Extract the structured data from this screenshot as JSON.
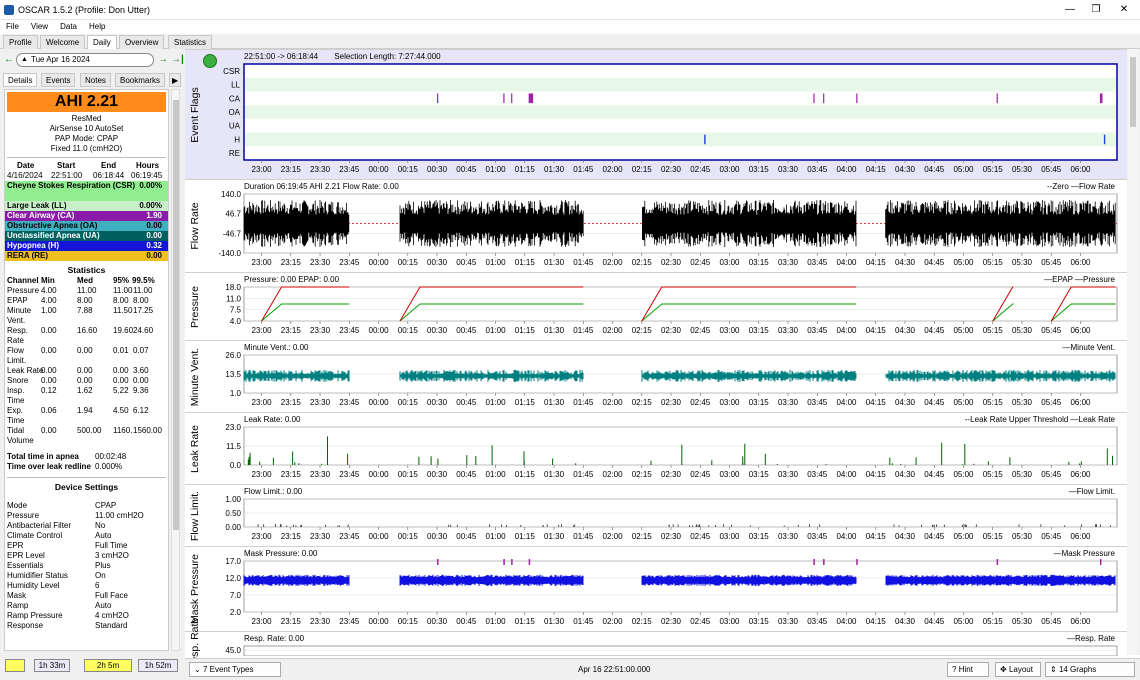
{
  "window": {
    "title": "OSCAR 1.5.2 (Profile: Don Utter)",
    "minimize": "—",
    "maximize": "❐",
    "close": "✕"
  },
  "menu": [
    "File",
    "View",
    "Data",
    "Help"
  ],
  "tabs": [
    "Profile",
    "Welcome",
    "Daily",
    "Overview",
    "Statistics"
  ],
  "active_tab": "Daily",
  "left": {
    "date": "Tue Apr 16 2024",
    "subtabs": [
      "Details",
      "Events",
      "Notes",
      "Bookmarks"
    ],
    "ahi": "AHI 2.21",
    "device": [
      "ResMed",
      "AirSense 10 AutoSet",
      "PAP Mode: CPAP",
      "Fixed 11.0 (cmH2O)"
    ],
    "session_headers": [
      "Date",
      "Start",
      "End",
      "Hours"
    ],
    "session_values": [
      "4/16/2024",
      "22:51:00",
      "06:18:44",
      "06:19:45"
    ],
    "events": [
      {
        "name": "Cheyne Stokes Respiration (CSR)",
        "value": "0.00%",
        "color": "#90ee90"
      },
      {
        "name": "Large Leak (LL)",
        "value": "0.00%",
        "color": "#c8f0c8"
      },
      {
        "name": "Clear Airway (CA)",
        "value": "1.90",
        "color": "#8a1aa8"
      },
      {
        "name": "Obstructive Apnea (OA)",
        "value": "0.00",
        "color": "#3fb0c0"
      },
      {
        "name": "Unclassified Apnea (UA)",
        "value": "0.00",
        "color": "#006060"
      },
      {
        "name": "Hypopnea (H)",
        "value": "0.32",
        "color": "#1515d8"
      },
      {
        "name": "RERA (RE)",
        "value": "0.00",
        "color": "#f0c020"
      }
    ],
    "stats_title": "Statistics",
    "stats_headers": [
      "Channel",
      "Min",
      "Med",
      "95%",
      "99.5%"
    ],
    "stats_rows": [
      {
        "name": [
          "Pressure"
        ],
        "min": "4.00",
        "med": "11.00",
        "p95": "11.00",
        "p995": "11.00"
      },
      {
        "name": [
          "EPAP"
        ],
        "min": "4.00",
        "med": "8.00",
        "p95": "8.00",
        "p995": "8.00"
      },
      {
        "name": [
          "Minute",
          "Vent."
        ],
        "min": "1.00",
        "med": "7.88",
        "p95": "11.50",
        "p995": "17.25"
      },
      {
        "name": [
          "Resp.",
          "Rate"
        ],
        "min": "0.00",
        "med": "16.60",
        "p95": "19.60",
        "p995": "24.60"
      },
      {
        "name": [
          "Flow",
          "Limit."
        ],
        "min": "0.00",
        "med": "0.00",
        "p95": "0.01",
        "p995": "0.07"
      },
      {
        "name": [
          "Leak Rate"
        ],
        "min": "0.00",
        "med": "0.00",
        "p95": "0.00",
        "p995": "3.60"
      },
      {
        "name": [
          "Snore"
        ],
        "min": "0.00",
        "med": "0.00",
        "p95": "0.00",
        "p995": "0.00"
      },
      {
        "name": [
          "Insp.",
          "Time"
        ],
        "min": "0.12",
        "med": "1.62",
        "p95": "5.22",
        "p995": "9.36"
      },
      {
        "name": [
          "Exp.",
          "Time"
        ],
        "min": "0.06",
        "med": "1.94",
        "p95": "4.50",
        "p995": "6.12"
      },
      {
        "name": [
          "Tidal",
          "Volume"
        ],
        "min": "0.00",
        "med": "500.00",
        "p95": "1160.",
        "p995": "1560.00"
      }
    ],
    "apnea_time_label": "Total time in apnea",
    "apnea_time": "00:02:48",
    "leak_label": "Time over leak redline",
    "leak_value": "0.000%",
    "settings_title": "Device Settings",
    "settings": [
      [
        "Mode",
        "CPAP"
      ],
      [
        "Pressure",
        "11.00 cmH2O"
      ],
      [
        "Antibacterial Filter",
        "No"
      ],
      [
        "Climate Control",
        "Auto"
      ],
      [
        "EPR",
        "Full Time"
      ],
      [
        "EPR Level",
        "3 cmH2O"
      ],
      [
        "Essentials",
        "Plus"
      ],
      [
        "Humidifier Status",
        "On"
      ],
      [
        "Humidity Level",
        "6"
      ],
      [
        "Mask",
        "Full Face"
      ],
      [
        "Ramp",
        "Auto"
      ],
      [
        "Ramp Pressure",
        "4 cmH2O"
      ],
      [
        "Response",
        "Standard"
      ]
    ],
    "bottom": [
      "",
      "1h 33m",
      "2h 5m",
      "1h 52m"
    ]
  },
  "graphs": {
    "x_ticks": [
      "23:00",
      "23:15",
      "23:30",
      "23:45",
      "00:00",
      "00:15",
      "00:30",
      "00:45",
      "01:00",
      "01:15",
      "01:30",
      "01:45",
      "02:00",
      "02:15",
      "02:30",
      "02:45",
      "03:00",
      "03:15",
      "03:30",
      "03:45",
      "04:00",
      "04:15",
      "04:30",
      "04:45",
      "05:00",
      "05:15",
      "05:30",
      "05:45",
      "06:00"
    ],
    "flags": {
      "label": "Event Flags",
      "header_range": "22:51:00 -> 06:18:44",
      "header_sel": "Selection Length: 7:27:44.000",
      "rows": [
        "CSR",
        "LL",
        "CA",
        "OA",
        "UA",
        "H",
        "RE"
      ],
      "ca_events": [
        "00:30",
        "01:04",
        "01:08",
        "01:17",
        "01:18",
        "03:43",
        "03:48",
        "04:05",
        "05:17",
        "06:10"
      ],
      "h_events": [
        "02:47",
        "06:12"
      ]
    },
    "flow": {
      "label": "Flow Rate",
      "header": "Duration 06:19:45 AHI 2.21 Flow Rate: 0.00",
      "legend": "--Zero —Flow Rate",
      "yticks": [
        "140.0",
        "46.7",
        "-46.7",
        "-140.0"
      ]
    },
    "pressure": {
      "label": "Pressure",
      "header": "Pressure: 0.00 EPAP: 0.00",
      "legend": "—EPAP —Pressure",
      "yticks": [
        "18.0",
        "11.0",
        "7.5",
        "4.0"
      ]
    },
    "minvent": {
      "label": "Minute Vent.",
      "header": "Minute Vent.: 0.00",
      "legend": "—Minute Vent.",
      "yticks": [
        "26.0",
        "13.5",
        "1.0"
      ]
    },
    "leak": {
      "label": "Leak Rate",
      "header": "Leak Rate: 0.00",
      "legend": "--Leak Rate Upper Threshold —Leak Rate",
      "yticks": [
        "23.0",
        "11.5",
        "0.0"
      ]
    },
    "flowlim": {
      "label": "Flow Limit.",
      "header": "Flow Limit.: 0.00",
      "legend": "—Flow Limit.",
      "yticks": [
        "1.00",
        "0.50",
        "0.00"
      ]
    },
    "mask": {
      "label": "Mask Pressure",
      "header": "Mask Pressure: 0.00",
      "legend": "—Mask Pressure",
      "yticks": [
        "17.0",
        "12.0",
        "7.0",
        "2.0"
      ]
    },
    "resp": {
      "label": "Resp. Rate",
      "header": "Resp. Rate: 0.00",
      "legend": "—Resp. Rate",
      "yticks": [
        "45.0"
      ]
    }
  },
  "status": {
    "event_types": "7 Event Types",
    "datetime": "Apr 16 22:51:00.000",
    "hint": "Hint",
    "layout": "Layout",
    "graphs": "14 Graphs"
  },
  "colors": {
    "ahi": "#ff8c1a",
    "flow": "#000000",
    "pressure": "#d00000",
    "epap": "#00a000",
    "minvent": "#008080",
    "leak": "#006400",
    "mask": "#1010e0",
    "flags_bg": "#e8f8e8",
    "sel_bg": "#e6e6f8"
  }
}
